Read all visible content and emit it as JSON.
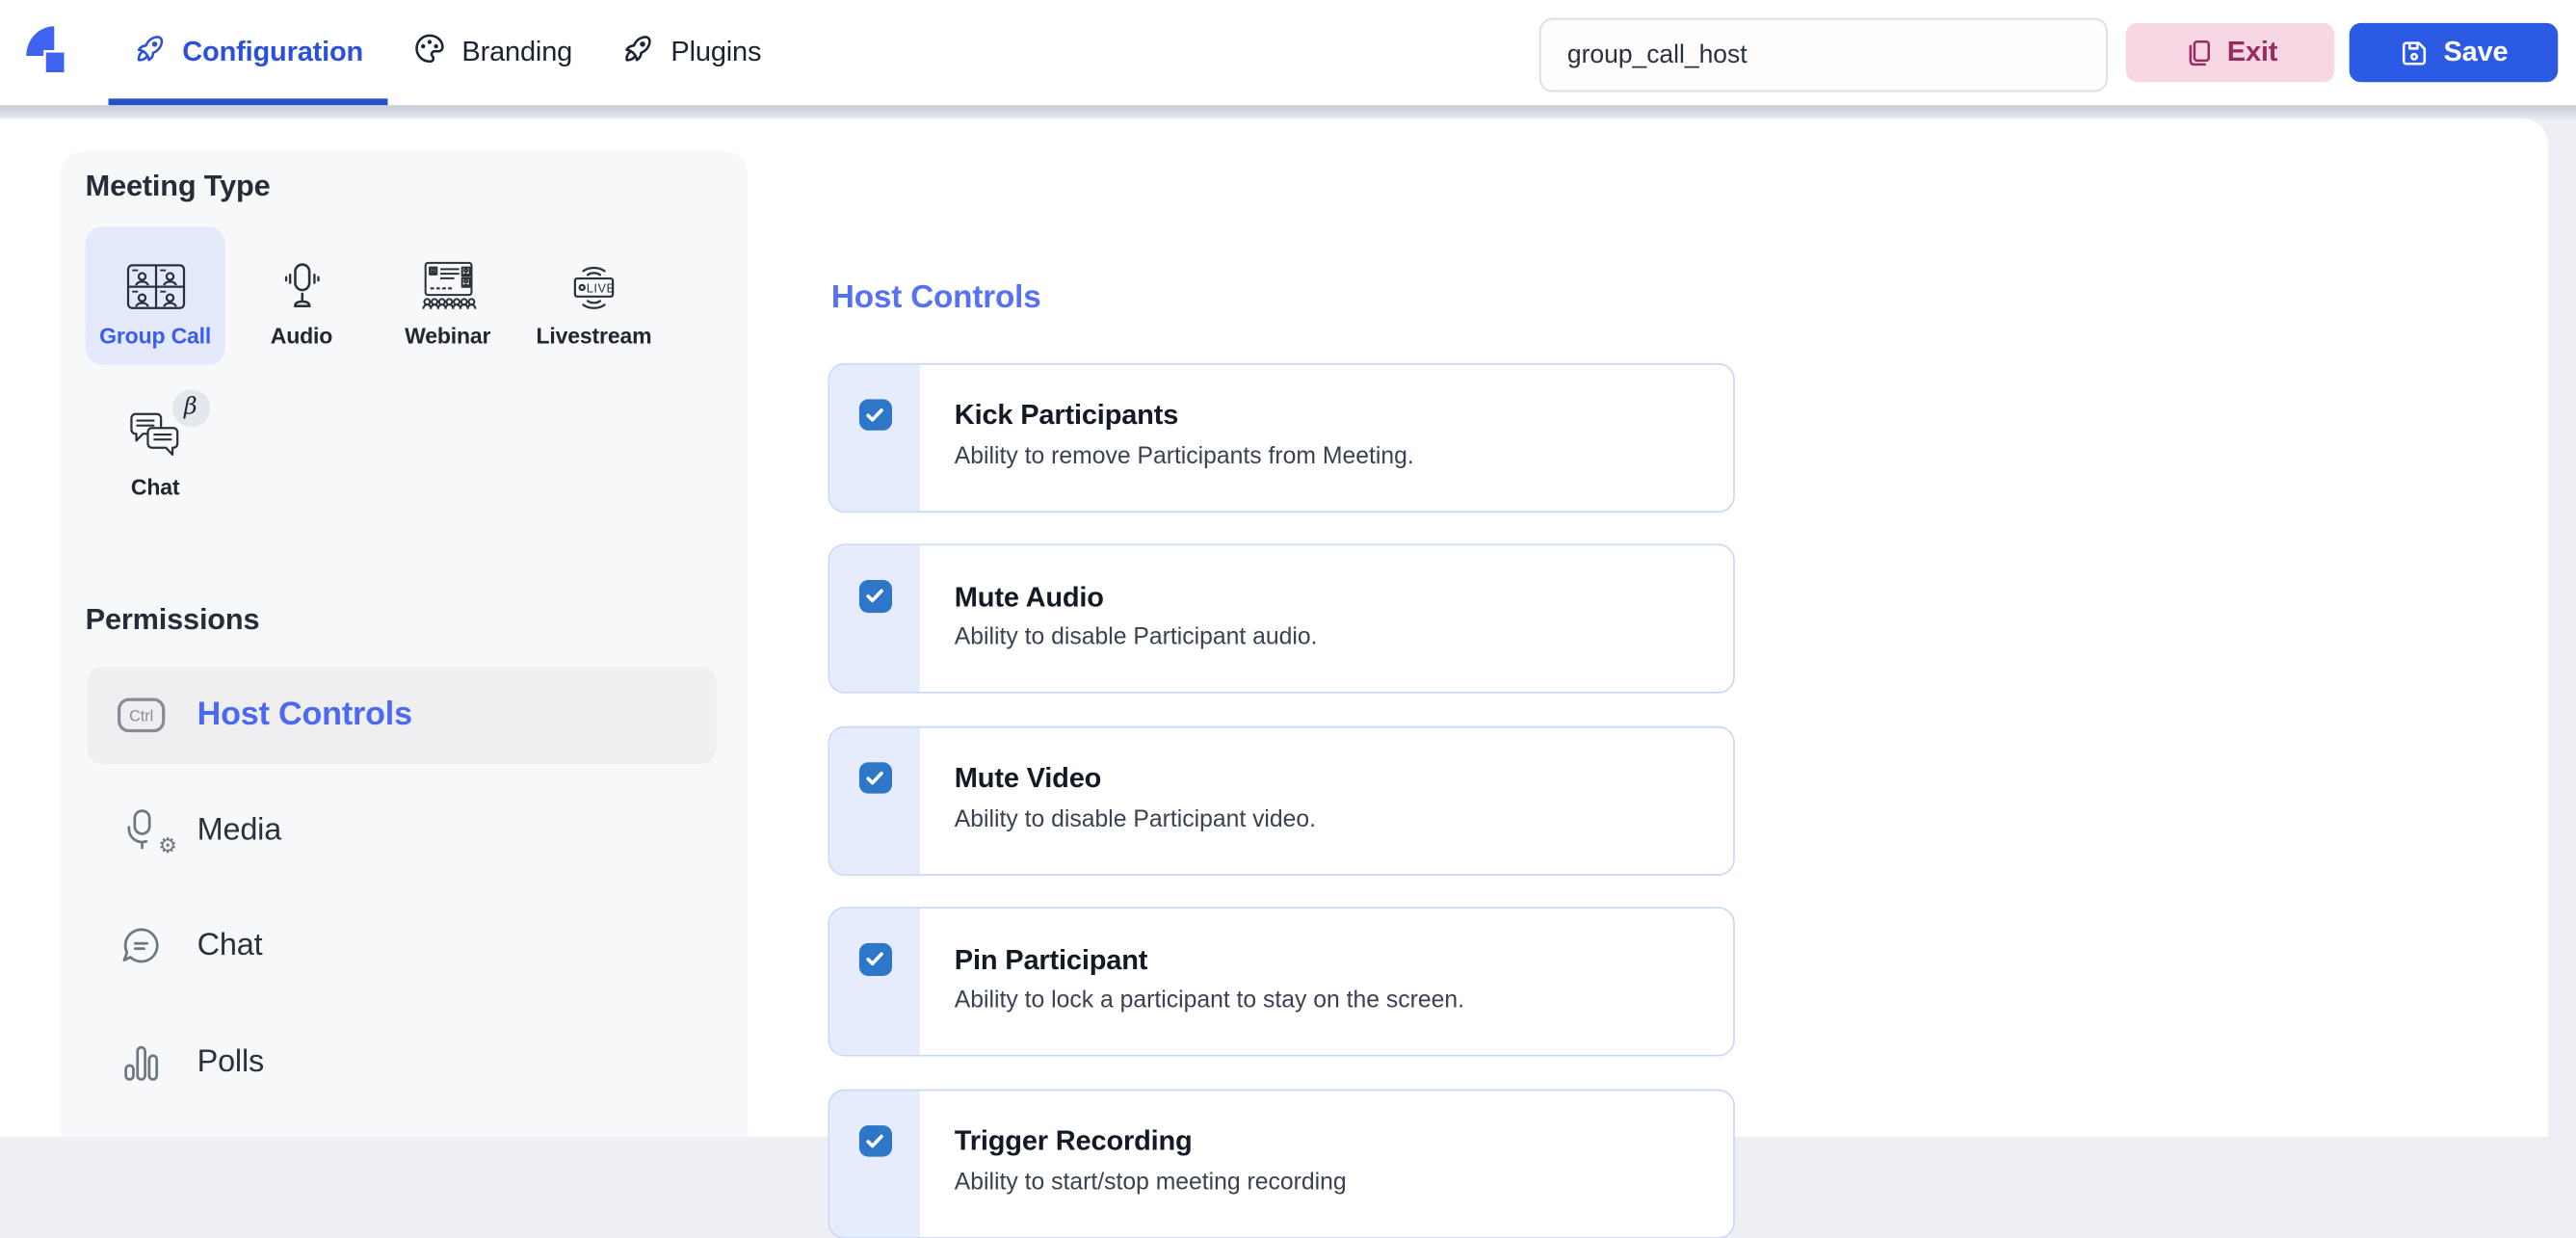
{
  "nav": {
    "tabs": [
      {
        "label": "Configuration",
        "active": true
      },
      {
        "label": "Branding",
        "active": false
      },
      {
        "label": "Plugins",
        "active": false
      }
    ],
    "room_input": {
      "value": "group_call_host"
    },
    "exit_label": "Exit",
    "save_label": "Save"
  },
  "sidebar": {
    "meeting_type": {
      "title": "Meeting Type",
      "options": [
        {
          "label": "Group Call",
          "selected": true
        },
        {
          "label": "Audio",
          "selected": false
        },
        {
          "label": "Webinar",
          "selected": false
        },
        {
          "label": "Livestream",
          "selected": false
        },
        {
          "label": "Chat",
          "selected": false,
          "badge": "β"
        }
      ]
    },
    "permissions_nav": {
      "title": "Permissions",
      "items": [
        {
          "label": "Host Controls",
          "active": true
        },
        {
          "label": "Media",
          "active": false
        },
        {
          "label": "Chat",
          "active": false
        },
        {
          "label": "Polls",
          "active": false
        }
      ]
    }
  },
  "main": {
    "title": "Host Controls",
    "permissions": [
      {
        "label": "Kick Participants",
        "description": "Ability to remove Participants from Meeting.",
        "checked": true
      },
      {
        "label": "Mute Audio",
        "description": "Ability to disable Participant audio.",
        "checked": true
      },
      {
        "label": "Mute Video",
        "description": "Ability to disable Participant video.",
        "checked": true
      },
      {
        "label": "Pin Participant",
        "description": "Ability to lock a participant to stay on the screen.",
        "checked": true
      },
      {
        "label": "Trigger Recording",
        "description": "Ability to start/stop meeting recording",
        "checked": true
      }
    ]
  },
  "colors": {
    "brand_blue": "#3e63f1",
    "active_tab_blue": "#2b51da",
    "tab_underline": "#2450c8",
    "save_button": "#2b5be4",
    "exit_button_bg": "#f8d7e4",
    "exit_button_text": "#9a2b5f",
    "selected_tile_bg": "#e4e9fb",
    "sidebar_bg": "#f7f8fa",
    "card_border": "#cad8f8",
    "card_strip": "#e7ecfc",
    "checkbox_blue": "#2e77c8",
    "heading_blue": "#5671f2"
  }
}
